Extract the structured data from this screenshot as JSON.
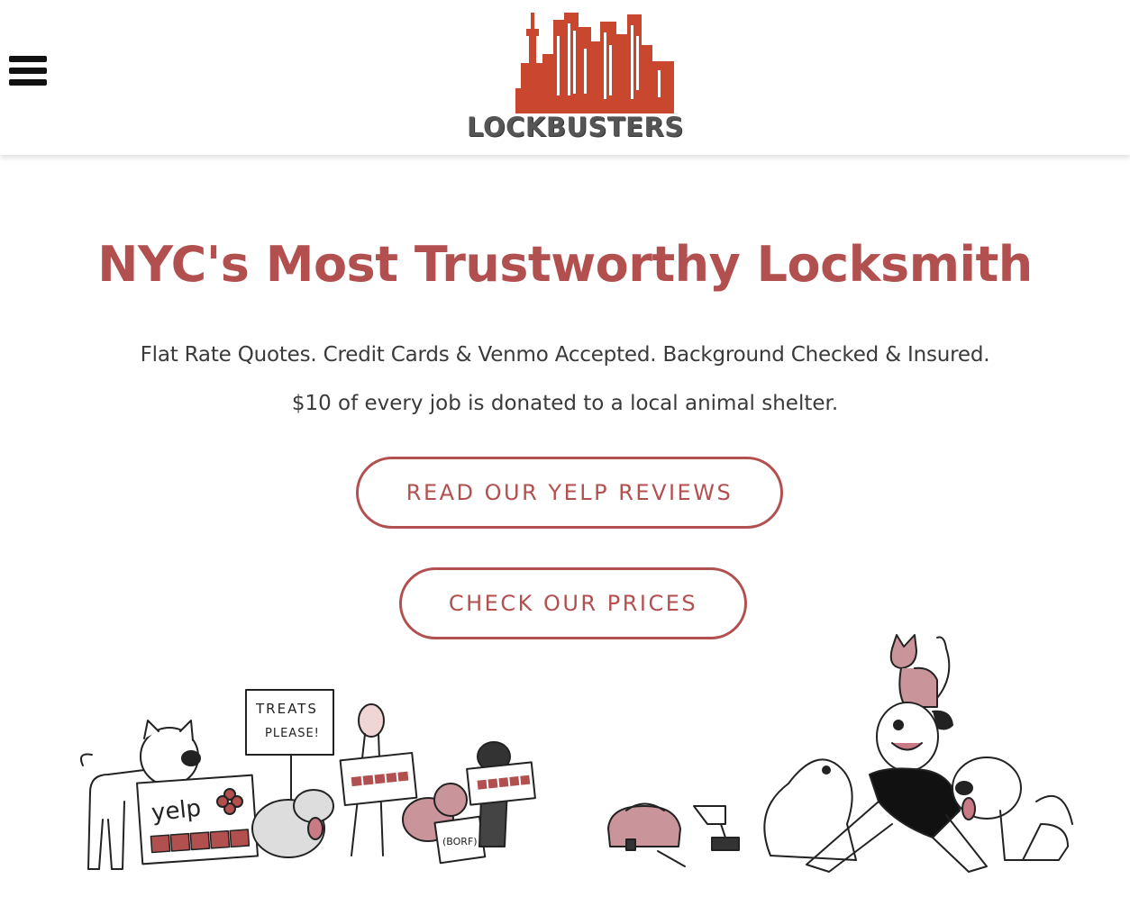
{
  "header": {
    "menu_icon": "hamburger-menu-icon",
    "logo_text": "LOCKBUSTERS",
    "logo_icon": "city-skyline-icon"
  },
  "hero": {
    "title": "NYC's Most Trustworthy Locksmith",
    "tagline_1": "Flat Rate Quotes. Credit Cards & Venmo Accepted. Background Checked & Insured.",
    "tagline_2": "$10 of every job is donated to a local animal shelter."
  },
  "actions": {
    "yelp_label": "READ OUR YELP REVIEWS",
    "prices_label": "CHECK OUR PRICES"
  },
  "illustrations": {
    "left": {
      "yelp_sign": "yelp",
      "treats_sign_line1": "TREATS",
      "treats_sign_line2": "PLEASE!",
      "borf_sign": "(BORF)"
    }
  },
  "colors": {
    "accent": "#b2504f",
    "logo_orange": "#c8472e",
    "logo_gray": "#555555"
  }
}
